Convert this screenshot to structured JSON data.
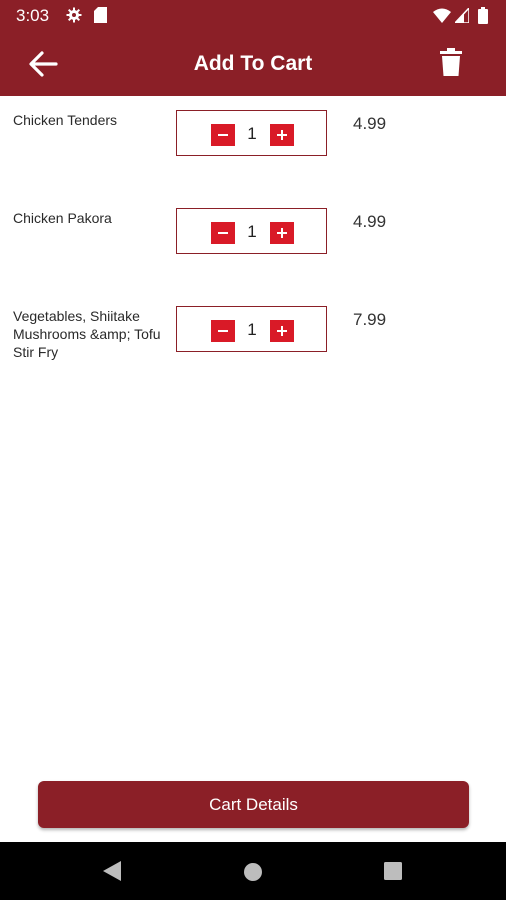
{
  "status_bar": {
    "time": "3:03",
    "icons": [
      "gear-icon",
      "sd-card-icon",
      "wifi-icon",
      "signal-icon",
      "battery-icon"
    ]
  },
  "app_bar": {
    "title": "Add To Cart",
    "back_icon": "arrow-left-icon",
    "delete_icon": "trash-icon"
  },
  "cart_items": [
    {
      "name": "Chicken Tenders",
      "quantity": "1",
      "price": "4.99"
    },
    {
      "name": "Chicken Pakora",
      "quantity": "1",
      "price": "4.99"
    },
    {
      "name": "Vegetables, Shiitake Mushrooms &amp; Tofu Stir Fry",
      "quantity": "1",
      "price": "7.99"
    }
  ],
  "footer": {
    "cart_details_label": "Cart Details"
  },
  "colors": {
    "primary": "#8b1f27",
    "stepper_button": "#d91a27",
    "nav_bar": "#000000"
  }
}
